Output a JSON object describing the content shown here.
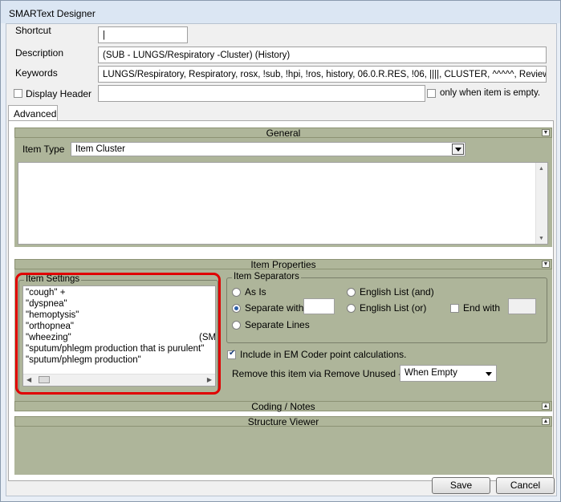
{
  "window": {
    "title": "SMARText Designer"
  },
  "form": {
    "shortcut_label": "Shortcut",
    "shortcut_value": "|",
    "description_label": "Description",
    "description_value": "(SUB  -  LUNGS/Respiratory  -Cluster)       (History)",
    "keywords_label": "Keywords",
    "keywords_value": "LUNGS/Respiratory, Respiratory, rosx, !sub, !hpi, !ros, history, 06.0.R.RES, !06, ||||, CLUSTER, ^^^^^, Review",
    "display_header_label": "Display Header",
    "display_header_value": "",
    "only_when_empty_label": "only when item is empty."
  },
  "tabs": [
    {
      "label": "Advanced"
    }
  ],
  "general": {
    "header": "General",
    "item_type_label": "Item Type",
    "item_type_value": "Item Cluster"
  },
  "item_properties": {
    "header": "Item Properties",
    "item_settings_title": "Item Settings",
    "item_settings_lines": [
      "\"cough\"     +",
      "\"dyspnea\"",
      "\"hemoptysis\"",
      "\"orthopnea\"",
      "\"wheezing\"",
      "\"sputum/phlegm production that is purulent\"",
      "\"sputum/phlegm production\""
    ],
    "wheezing_suffix": "(SM",
    "separators_title": "Item Separators",
    "as_is_label": "As Is",
    "separate_with_label": "Separate with",
    "separate_lines_label": "Separate Lines",
    "english_and_label": "English List (and)",
    "english_or_label": "English List (or)",
    "end_with_label": "End with",
    "em_coder_label": "Include in EM Coder point calculations.",
    "remove_label": "Remove this item via Remove Unused -",
    "remove_value": "When Empty"
  },
  "coding_notes": {
    "header": "Coding / Notes"
  },
  "structure_viewer": {
    "header": "Structure Viewer"
  },
  "buttons": {
    "save": "Save",
    "cancel": "Cancel"
  },
  "colors": {
    "section_bg": "#aeb59a",
    "highlight_border": "#e00000"
  }
}
